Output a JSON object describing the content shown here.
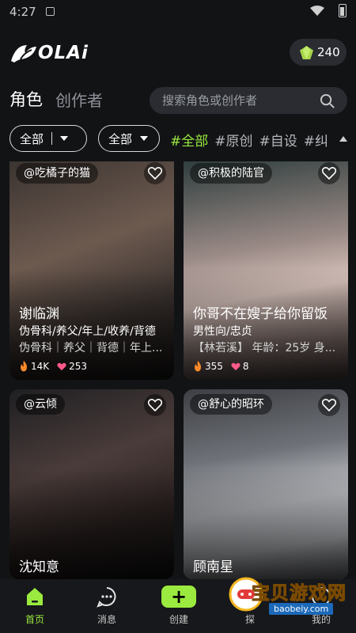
{
  "status": {
    "time": "4:27"
  },
  "header": {
    "logo_text": "OLAi",
    "coins": "240",
    "logo_icon": "leaf-logo-icon",
    "coin_icon": "gem-icon"
  },
  "tabs": {
    "active": "角色",
    "inactive": "创作者"
  },
  "search": {
    "placeholder": "搜索角色或创作者",
    "icon": "search-icon"
  },
  "filters": {
    "dropdown1": "全部",
    "dropdown2": "全部",
    "tags": [
      "#全部",
      "#原创",
      "#自设",
      "#纠"
    ]
  },
  "cards": [
    {
      "author": "@吃橘子的猫",
      "name": "谢临渊",
      "tags": "伪骨科/养父/年上/收养/背德",
      "desc": "伪骨科｜养父｜背德｜年上...",
      "heat": "14K",
      "likes": "253"
    },
    {
      "author": "@积极的陆官",
      "name": "你哥不在嫂子给你留饭",
      "tags": "男性向/忠贞",
      "desc": "【林若溪】 年龄：25岁 身...",
      "heat": "355",
      "likes": "8"
    },
    {
      "author": "@云倾",
      "name": "沈知意"
    },
    {
      "author": "@舒心的昭环",
      "name": "顾南星"
    }
  ],
  "nav": {
    "home": "首页",
    "messages": "消息",
    "create": "创建",
    "explore": "探",
    "me": "我的"
  },
  "watermark": {
    "title": "宝贝游戏网",
    "url": "baobeiy.com"
  },
  "colors": {
    "accent": "#9bea3f",
    "background": "#121315"
  }
}
